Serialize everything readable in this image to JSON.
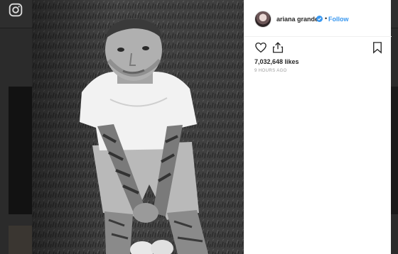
{
  "background": {
    "logo_icon": "instagram-icon"
  },
  "post": {
    "username": "ariana grande",
    "follow_label": "Follow",
    "dot": "•",
    "likes": "7,032,648 likes",
    "timestamp": "9 HOURS AGO",
    "icons": {
      "verified": "verified-badge-icon",
      "like": "heart-icon",
      "share": "share-icon",
      "save": "bookmark-icon"
    },
    "photo": "black-and-white photo of a tattooed man in a white t-shirt sitting on grass"
  },
  "colors": {
    "follow": "#3897f0",
    "verified": "#3897f0",
    "text": "#262626",
    "muted": "#999999"
  }
}
